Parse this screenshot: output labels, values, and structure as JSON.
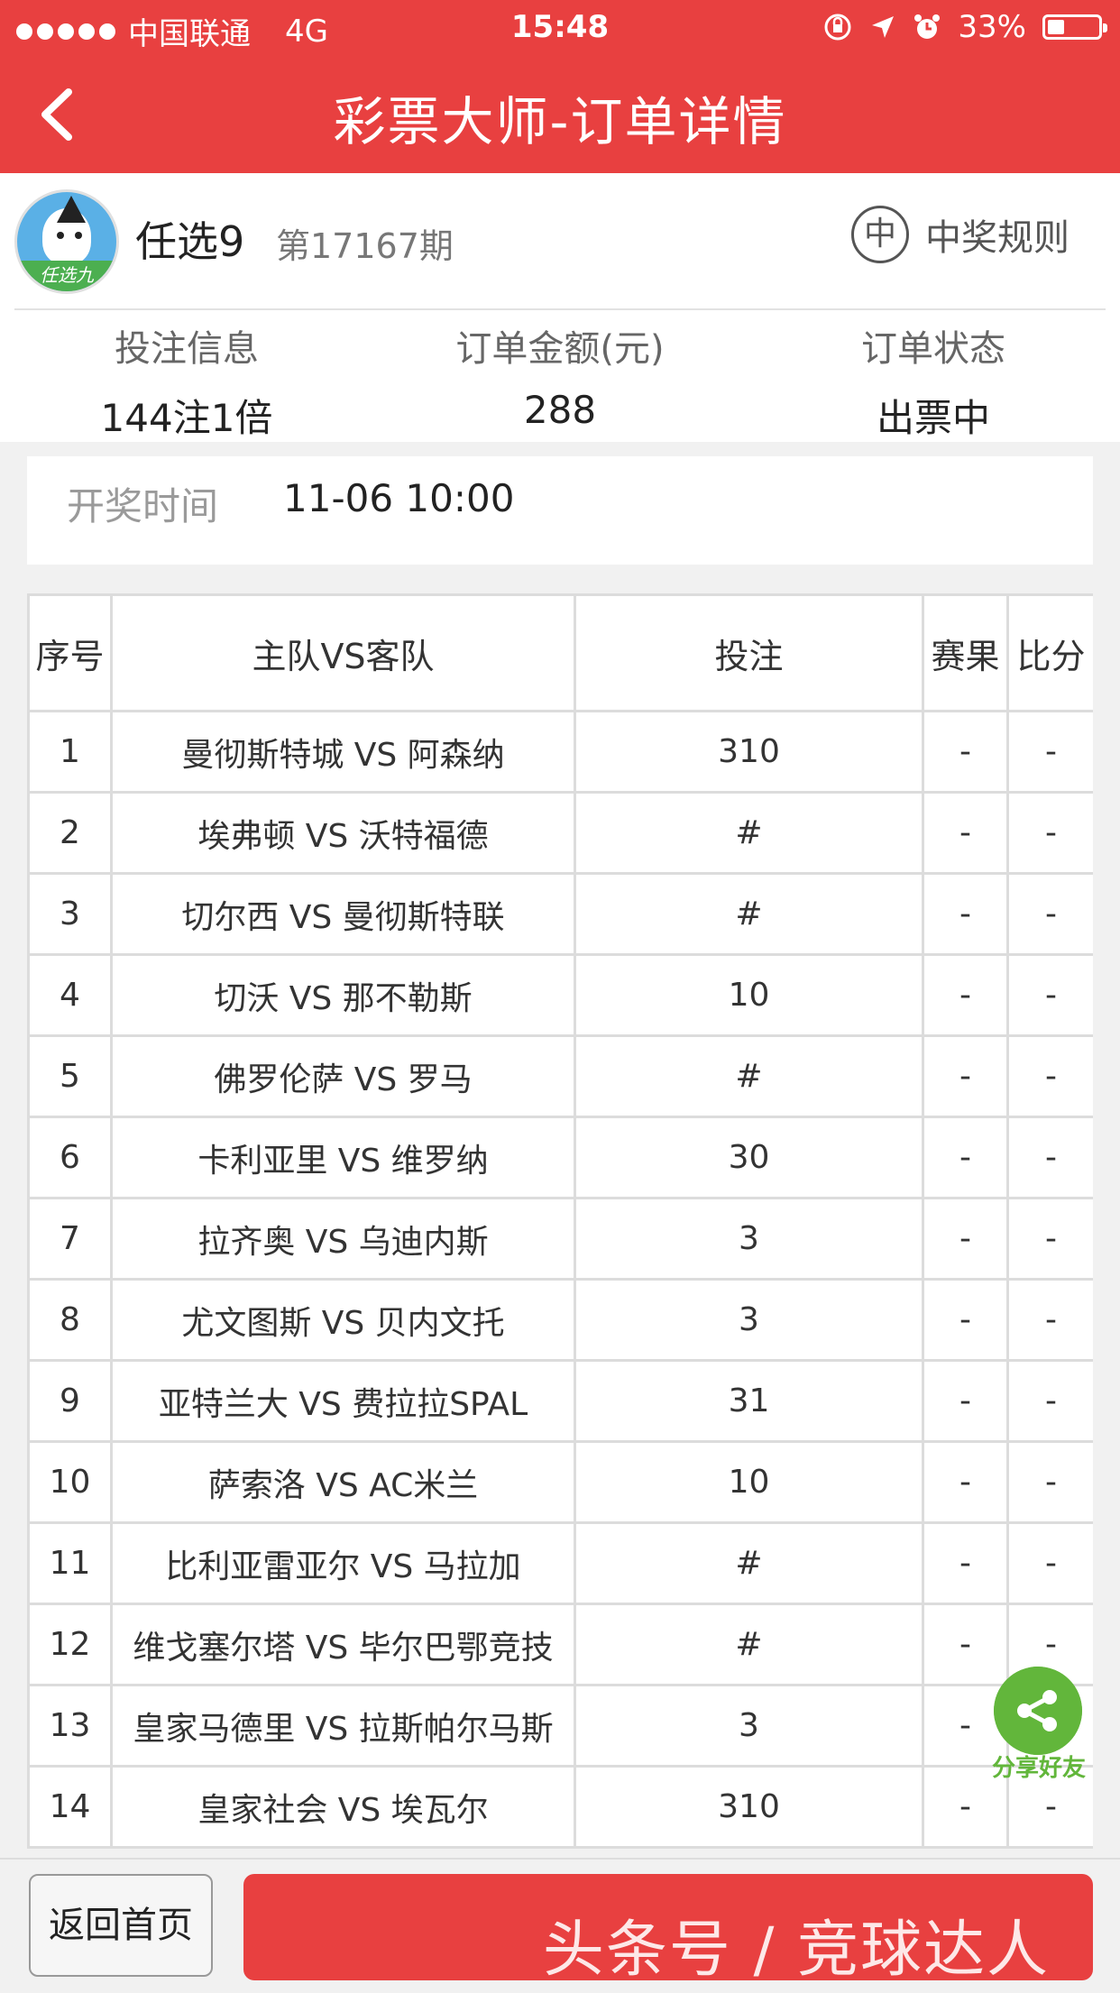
{
  "status_bar": {
    "carrier": "中国联通",
    "network": "4G",
    "time": "15:48",
    "battery": "33%",
    "battery_level": 0.33
  },
  "nav": {
    "title": "彩票大师-订单详情"
  },
  "lottery": {
    "logo_text": "任选九",
    "game_name": "任选9",
    "issue": "第17167期",
    "rules_icon": "中",
    "rules_label": "中奖规则"
  },
  "summary": [
    {
      "label": "投注信息",
      "value": "144注1倍"
    },
    {
      "label": "订单金额(元)",
      "value": "288"
    },
    {
      "label": "订单状态",
      "value": "出票中"
    }
  ],
  "draw_time": {
    "label": "开奖时间",
    "value": "11-06 10:00"
  },
  "table": {
    "headers": [
      "序号",
      "主队VS客队",
      "投注",
      "赛果",
      "比分"
    ],
    "rows": [
      [
        "1",
        "曼彻斯特城 VS 阿森纳",
        "310",
        "-",
        "-"
      ],
      [
        "2",
        "埃弗顿 VS 沃特福德",
        "#",
        "-",
        "-"
      ],
      [
        "3",
        "切尔西 VS 曼彻斯特联",
        "#",
        "-",
        "-"
      ],
      [
        "4",
        "切沃 VS 那不勒斯",
        "10",
        "-",
        "-"
      ],
      [
        "5",
        "佛罗伦萨 VS 罗马",
        "#",
        "-",
        "-"
      ],
      [
        "6",
        "卡利亚里 VS 维罗纳",
        "30",
        "-",
        "-"
      ],
      [
        "7",
        "拉齐奥 VS 乌迪内斯",
        "3",
        "-",
        "-"
      ],
      [
        "8",
        "尤文图斯 VS 贝内文托",
        "3",
        "-",
        "-"
      ],
      [
        "9",
        "亚特兰大 VS 费拉拉SPAL",
        "31",
        "-",
        "-"
      ],
      [
        "10",
        "萨索洛 VS AC米兰",
        "10",
        "-",
        "-"
      ],
      [
        "11",
        "比利亚雷亚尔 VS 马拉加",
        "#",
        "-",
        "-"
      ],
      [
        "12",
        "维戈塞尔塔 VS 毕尔巴鄂竞技",
        "#",
        "-",
        "-"
      ],
      [
        "13",
        "皇家马德里 VS 拉斯帕尔马斯",
        "3",
        "-",
        "-"
      ],
      [
        "14",
        "皇家社会 VS 埃瓦尔",
        "310",
        "-",
        "-"
      ]
    ]
  },
  "share": {
    "label": "分享好友"
  },
  "footer": {
    "home_label": "返回首页",
    "watermark": "头条号 / 竞球达人"
  },
  "colors": {
    "brand_red": "#e84040",
    "share_green": "#62b63b"
  }
}
